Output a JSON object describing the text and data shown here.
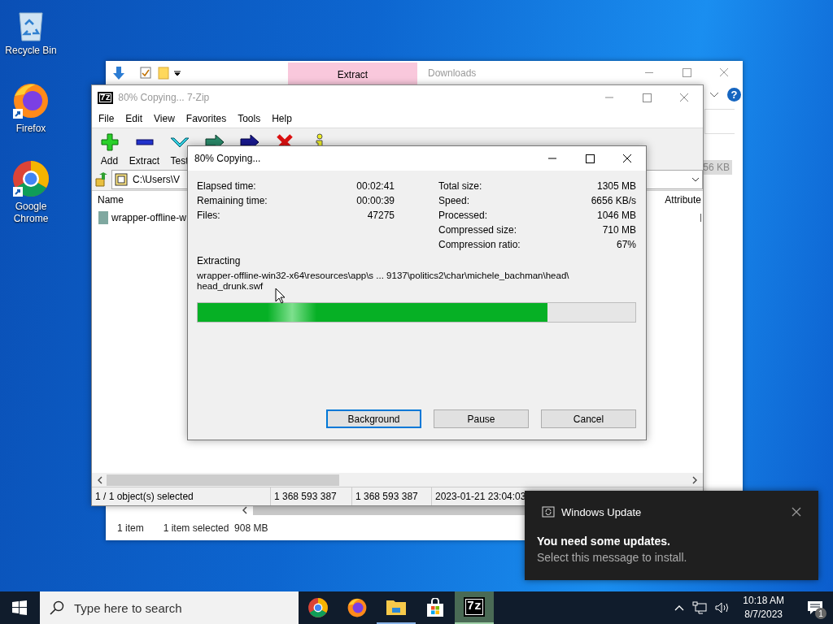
{
  "desktop_icons": [
    {
      "kind": "recycle",
      "label": "Recycle Bin"
    },
    {
      "kind": "firefox",
      "label": "Firefox"
    },
    {
      "kind": "chrome",
      "label": "Google Chrome"
    }
  ],
  "explorer": {
    "ribbon_tab": "Extract",
    "title": "Downloads",
    "help_glyph": "?",
    "size_fragment": "56 KB",
    "status": [
      "1 item",
      "1 item selected  908 MB"
    ]
  },
  "sevenzip": {
    "logo": "7z",
    "title": "80% Copying... 7-Zip",
    "menu": [
      "File",
      "Edit",
      "View",
      "Favorites",
      "Tools",
      "Help"
    ],
    "toolbar": [
      {
        "kind": "add",
        "label": "Add"
      },
      {
        "kind": "extract",
        "label": "Extract"
      },
      {
        "kind": "test",
        "label": "Test"
      },
      {
        "kind": "copy"
      },
      {
        "kind": "move"
      },
      {
        "kind": "delete"
      },
      {
        "kind": "info"
      }
    ],
    "path": "C:\\Users\\V",
    "columns": [
      "Name",
      "Attribute"
    ],
    "rows": [
      {
        "name": "wrapper-offline-w"
      }
    ],
    "status": [
      "1 / 1 object(s) selected",
      "1 368 593 387",
      "1 368 593 387",
      "2023-01-21 23:04:03"
    ]
  },
  "dialog": {
    "title": "80% Copying...",
    "left_stats": [
      {
        "label": "Elapsed time:",
        "value": "00:02:41"
      },
      {
        "label": "Remaining time:",
        "value": "00:00:39"
      },
      {
        "label": "Files:",
        "value": "47275"
      }
    ],
    "right_stats": [
      {
        "label": "Total size:",
        "value": "1305 MB"
      },
      {
        "label": "Speed:",
        "value": "6656 KB/s"
      },
      {
        "label": "Processed:",
        "value": "1046 MB"
      },
      {
        "label": "Compressed size:",
        "value": "710 MB"
      },
      {
        "label": "Compression ratio:",
        "value": "67%"
      }
    ],
    "operation": "Extracting",
    "file_path": [
      "wrapper-offline-win32-x64\\resources\\app\\s ... 9137\\politics2\\char\\michele_bachman\\head\\",
      "head_drunk.swf"
    ],
    "level": 0.8,
    "buttons": [
      {
        "label": "Background",
        "focused": true
      },
      {
        "label": "Pause",
        "focused": false
      },
      {
        "label": "Cancel",
        "focused": false
      }
    ]
  },
  "notification": {
    "app": "Windows Update",
    "heading": "You need some updates.",
    "message": "Select this message to install."
  },
  "taskbar": {
    "search_placeholder": "Type here to search",
    "apps": [
      {
        "kind": "chrome",
        "running": false,
        "active": false
      },
      {
        "kind": "firefox",
        "running": false,
        "active": false
      },
      {
        "kind": "explorer",
        "running": true,
        "active": false
      },
      {
        "kind": "store",
        "running": false,
        "active": false
      },
      {
        "kind": "sevenzip",
        "logo": "7z",
        "running": true,
        "active": true
      }
    ],
    "time": "10:18 AM",
    "date": "8/7/2023",
    "notification_count": "1"
  }
}
